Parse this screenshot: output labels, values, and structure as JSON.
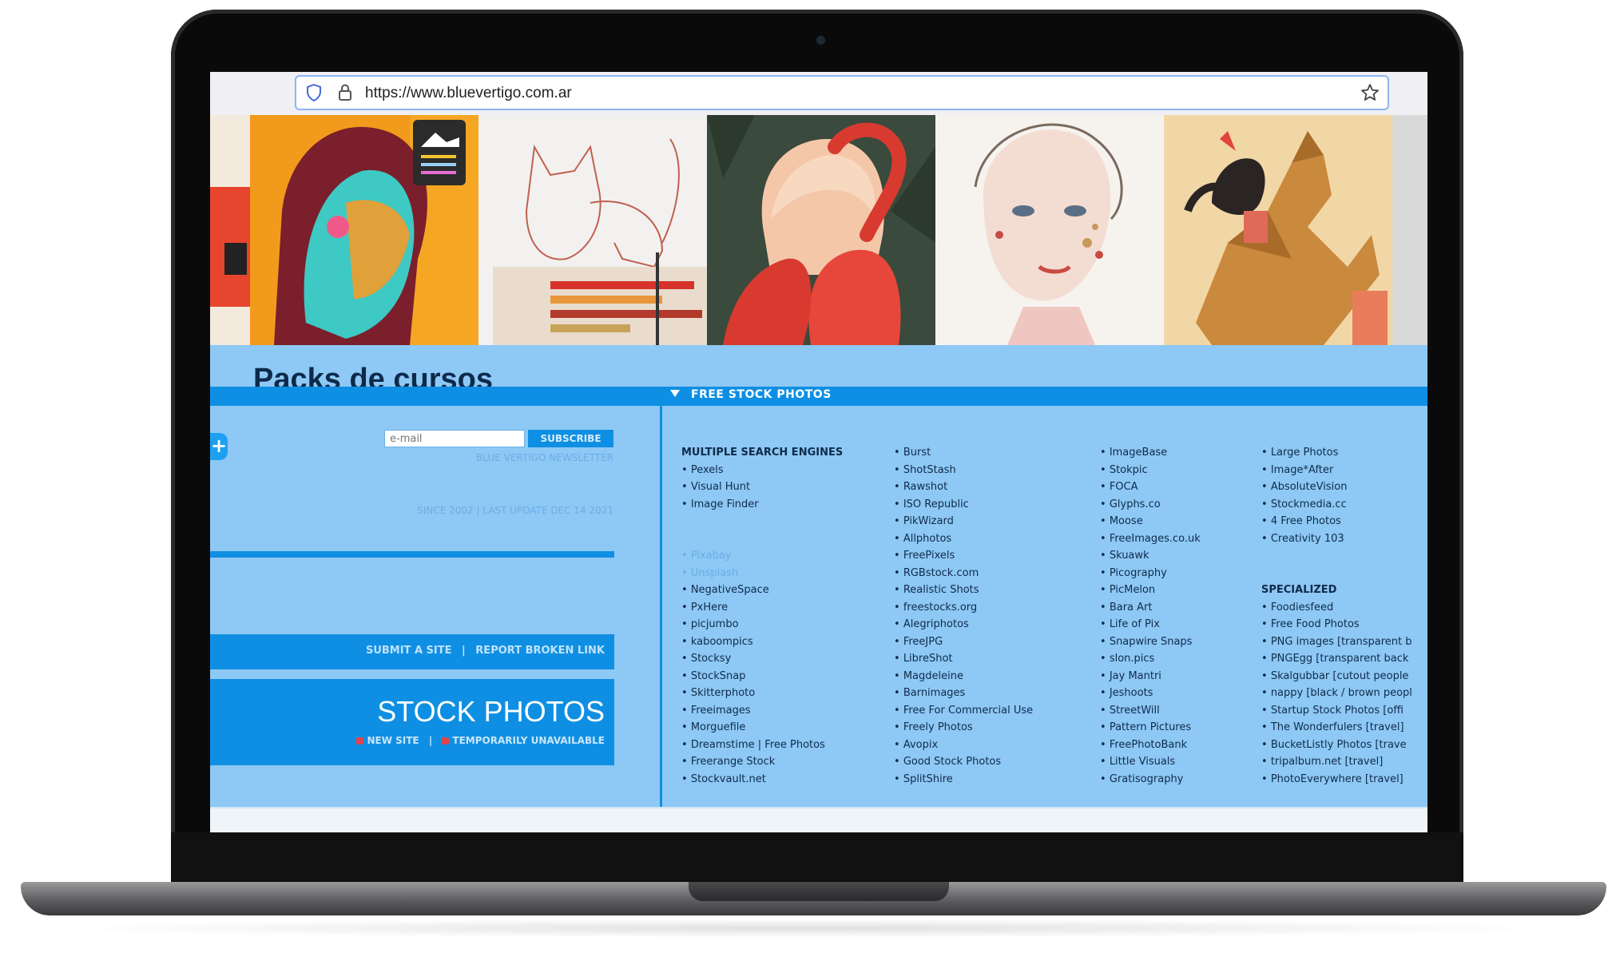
{
  "browser": {
    "url": "https://www.bluevertigo.com.ar"
  },
  "page": {
    "heading": "Packs de cursos",
    "section_title": "FREE STOCK PHOTOS",
    "newsletter": {
      "email_placeholder": "e-mail",
      "subscribe_label": "SUBSCRIBE",
      "label": "BLUE VERTIGO NEWSLETTER"
    },
    "update_text": "SINCE 2002 | LAST UPDATE DEC 14 2021",
    "submit_link": "SUBMIT A SITE",
    "separator": "|",
    "report_link": "REPORT BROKEN LINK",
    "stock_title": "STOCK PHOTOS",
    "legend_new": "NEW SITE",
    "legend_unavailable": "TEMPORARILY UNAVAILABLE",
    "plus_label": "+"
  },
  "columns": [
    {
      "items": [
        {
          "text": "MULTIPLE SEARCH ENGINES",
          "kind": "heading"
        },
        {
          "text": "Pexels"
        },
        {
          "text": "Visual Hunt"
        },
        {
          "text": "Image Finder"
        },
        {
          "text": "",
          "kind": "blank"
        },
        {
          "text": "",
          "kind": "blank"
        },
        {
          "text": "Pixabay",
          "kind": "faded"
        },
        {
          "text": "Unsplash",
          "kind": "faded"
        },
        {
          "text": "NegativeSpace"
        },
        {
          "text": "PxHere"
        },
        {
          "text": "picjumbo"
        },
        {
          "text": "kaboompics"
        },
        {
          "text": "Stocksy"
        },
        {
          "text": "StockSnap"
        },
        {
          "text": "Skitterphoto"
        },
        {
          "text": "Freeimages"
        },
        {
          "text": "Morguefile"
        },
        {
          "text": "Dreamstime | Free Photos"
        },
        {
          "text": "Freerange Stock"
        },
        {
          "text": "Stockvault.net"
        }
      ]
    },
    {
      "items": [
        {
          "text": "Burst"
        },
        {
          "text": "ShotStash"
        },
        {
          "text": "Rawshot"
        },
        {
          "text": "ISO Republic"
        },
        {
          "text": "PikWizard"
        },
        {
          "text": "Allphotos"
        },
        {
          "text": "FreePixels"
        },
        {
          "text": "RGBstock.com"
        },
        {
          "text": "Realistic Shots"
        },
        {
          "text": "freestocks.org"
        },
        {
          "text": "Alegriphotos"
        },
        {
          "text": "FreeJPG"
        },
        {
          "text": "LibreShot"
        },
        {
          "text": "Magdeleine"
        },
        {
          "text": "Barnimages"
        },
        {
          "text": "Free For Commercial Use"
        },
        {
          "text": "Freely Photos"
        },
        {
          "text": "Avopix"
        },
        {
          "text": "Good Stock Photos"
        },
        {
          "text": "SplitShire"
        }
      ]
    },
    {
      "items": [
        {
          "text": "ImageBase"
        },
        {
          "text": "Stokpic"
        },
        {
          "text": "FOCA"
        },
        {
          "text": "Glyphs.co"
        },
        {
          "text": "Moose"
        },
        {
          "text": "FreeImages.co.uk"
        },
        {
          "text": "Skuawk"
        },
        {
          "text": "Picography"
        },
        {
          "text": "PicMelon"
        },
        {
          "text": "Bara Art"
        },
        {
          "text": "Life of Pix"
        },
        {
          "text": "Snapwire Snaps"
        },
        {
          "text": "slon.pics"
        },
        {
          "text": "Jay Mantri"
        },
        {
          "text": "Jeshoots"
        },
        {
          "text": "StreetWill"
        },
        {
          "text": "Pattern Pictures"
        },
        {
          "text": "FreePhotoBank"
        },
        {
          "text": "Little Visuals"
        },
        {
          "text": "Gratisography"
        }
      ]
    },
    {
      "items": [
        {
          "text": "Large Photos"
        },
        {
          "text": "Image*After"
        },
        {
          "text": "AbsoluteVision"
        },
        {
          "text": "Stockmedia.cc"
        },
        {
          "text": "4 Free Photos"
        },
        {
          "text": "Creativity 103"
        },
        {
          "text": "",
          "kind": "blank"
        },
        {
          "text": "",
          "kind": "blank"
        },
        {
          "text": "SPECIALIZED",
          "kind": "heading"
        },
        {
          "text": "Foodiesfeed"
        },
        {
          "text": "Free Food Photos"
        },
        {
          "text": "PNG images [transparent b"
        },
        {
          "text": "PNGEgg [transparent back"
        },
        {
          "text": "Skalgubbar [cutout people"
        },
        {
          "text": "nappy [black / brown peopl"
        },
        {
          "text": "Startup Stock Photos [offi"
        },
        {
          "text": "The Wonderfulers [travel]"
        },
        {
          "text": "BucketListly Photos [trave"
        },
        {
          "text": "tripalbum.net [travel]"
        },
        {
          "text": "PhotoEverywhere [travel]"
        }
      ]
    }
  ],
  "icons": [
    "shield-icon",
    "lock-icon",
    "star-icon",
    "arrow-down-icon",
    "plus-icon"
  ],
  "colors": {
    "page_bg": "#8ec8f5",
    "accent_blue": "#0f8fe3",
    "link_text": "#0f2b49",
    "faded_text": "#6aaee6",
    "new_site_marker": "#e0454c"
  }
}
